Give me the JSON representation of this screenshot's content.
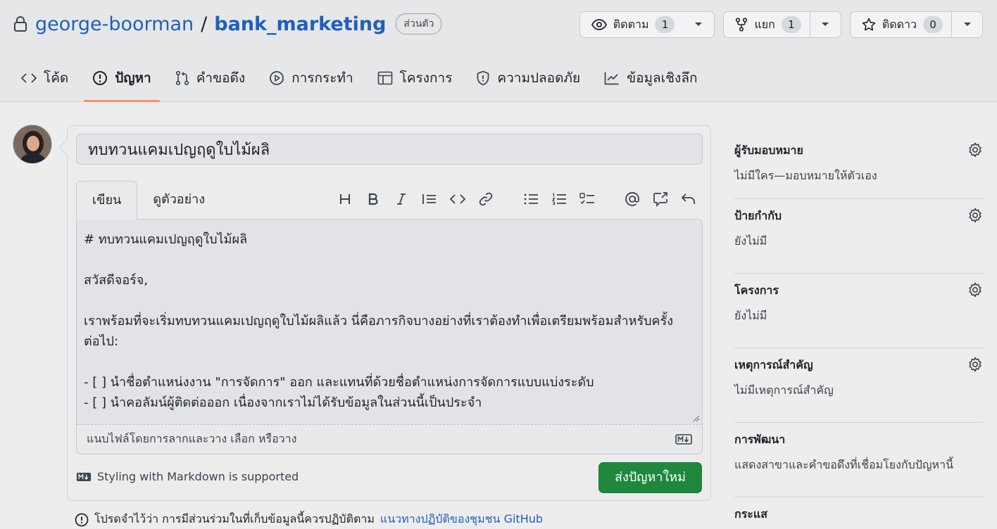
{
  "repo": {
    "owner": "george-boorman",
    "separator": "/",
    "name": "bank_marketing",
    "visibility": "ส่วนตัว"
  },
  "actions": {
    "watch": {
      "label": "ติดตาม",
      "count": "1"
    },
    "fork": {
      "label": "แยก",
      "count": "1"
    },
    "star": {
      "label": "ติดดาว",
      "count": "0"
    }
  },
  "tabs": [
    {
      "label": "โค้ด",
      "icon": "code-icon"
    },
    {
      "label": "ปัญหา",
      "icon": "issue-icon"
    },
    {
      "label": "คำขอดึง",
      "icon": "pull-request-icon"
    },
    {
      "label": "การกระทำ",
      "icon": "play-icon"
    },
    {
      "label": "โครงการ",
      "icon": "table-icon"
    },
    {
      "label": "ความปลอดภัย",
      "icon": "shield-icon"
    },
    {
      "label": "ข้อมูลเชิงลึก",
      "icon": "graph-icon"
    }
  ],
  "form": {
    "title_value": "ทบทวนแคมเปญฤดูใบไม้ผลิ",
    "tab_write": "เขียน",
    "tab_preview": "ดูตัวอย่าง",
    "body_value": "# ทบทวนแคมเปญฤดูใบไม้ผลิ\n\nสวัสดีจอร์จ,\n\nเราพร้อมที่จะเริ่มทบทวนแคมเปญฤดูใบไม้ผลิแล้ว นี่คือภารกิจบางอย่างที่เราต้องทำเพื่อเตรียมพร้อมสำหรับครั้งต่อไป:\n\n- [ ] นำชื่อตำแหน่งงาน \"การจัดการ\" ออก และแทนที่ด้วยชื่อตำแหน่งการจัดการแบบแบ่งระดับ\n- [ ] นำคอลัมน์ผู้ติดต่อออก เนื่องจากเราไม่ได้รับข้อมูลในส่วนนี้เป็นประจำ",
    "attach_hint": "แนบไฟล์โดยการลากและวาง เลือก หรือวาง",
    "markdown_note": "Styling with Markdown is supported",
    "submit_label": "ส่งปัญหาใหม่"
  },
  "footer": {
    "note": "โปรดจำไว้ว่า การมีส่วนร่วมในที่เก็บข้อมูลนี้ควรปฏิบัติตาม",
    "link": "แนวทางปฏิบัติของชุมชน GitHub"
  },
  "sidebar": [
    {
      "heading": "ผู้รับมอบหมาย",
      "value": "ไม่มีใคร—มอบหมายให้ตัวเอง"
    },
    {
      "heading": "ป้ายกำกับ",
      "value": "ยังไม่มี"
    },
    {
      "heading": "โครงการ",
      "value": "ยังไม่มี"
    },
    {
      "heading": "เหตุการณ์สำคัญ",
      "value": "ไม่มีเหตุการณ์สำคัญ"
    },
    {
      "heading": "การพัฒนา",
      "value": "แสดงสาขาและคำขอดึงที่เชื่อมโยงกับปัญหานี้"
    },
    {
      "heading": "กระแส",
      "value": ""
    }
  ],
  "colors": {
    "accent_link": "#1f5fbf",
    "submit_green": "#1f883d",
    "active_tab_underline": "#fd8c73"
  }
}
